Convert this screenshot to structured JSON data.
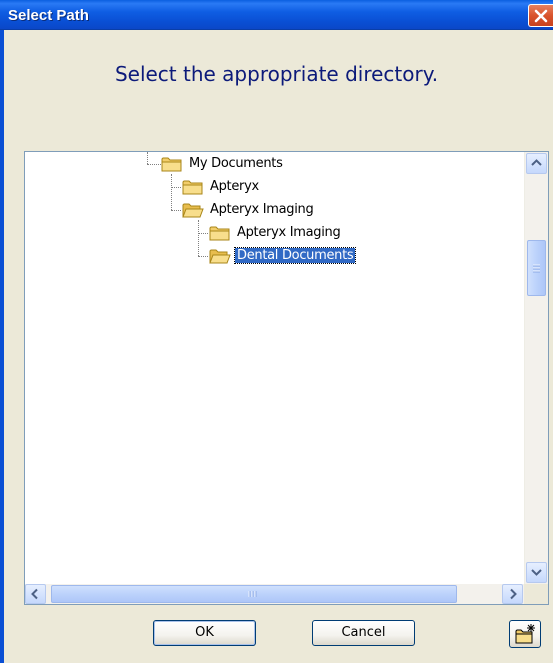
{
  "window": {
    "title": "Select Path"
  },
  "heading": "Select the appropriate directory.",
  "tree": {
    "items": [
      {
        "label": "My Documents",
        "level": 0,
        "selected": false
      },
      {
        "label": "Apteryx",
        "level": 1,
        "selected": false
      },
      {
        "label": "Apteryx Imaging",
        "level": 1,
        "selected": false
      },
      {
        "label": "Apteryx Imaging",
        "level": 2,
        "selected": false
      },
      {
        "label": "Dental Documents",
        "level": 2,
        "selected": true
      }
    ]
  },
  "buttons": {
    "ok": "OK",
    "cancel": "Cancel"
  },
  "icons": {
    "close": "close-icon",
    "folder": "folder-icon",
    "new_folder": "new-folder-icon"
  },
  "colors": {
    "titlebar": "#0a4fd4",
    "heading_text": "#0c1a7a",
    "selection": "#316ac5",
    "dialog_bg": "#ece9d8"
  }
}
